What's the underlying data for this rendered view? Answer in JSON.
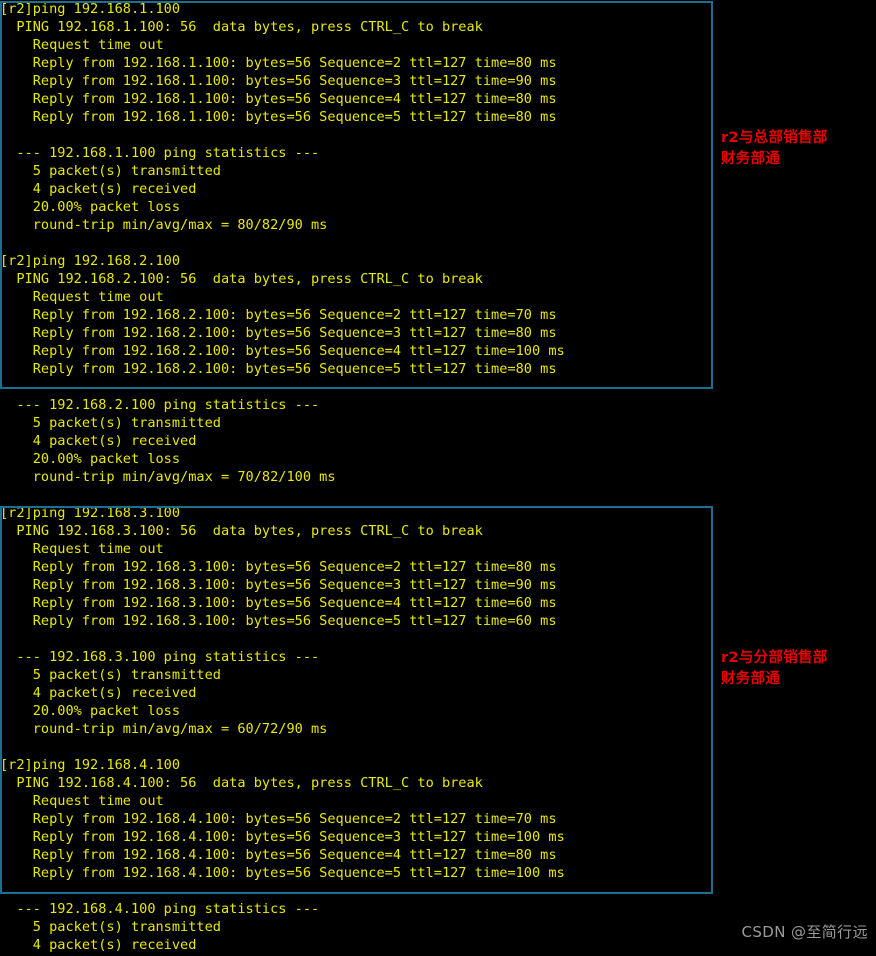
{
  "terminal": {
    "prompt_host": "r2",
    "text_color": "#e8e800",
    "background_color": "#000000",
    "lines": [
      "[r2]ping 192.168.1.100",
      "  PING 192.168.1.100: 56  data bytes, press CTRL_C to break",
      "    Request time out",
      "    Reply from 192.168.1.100: bytes=56 Sequence=2 ttl=127 time=80 ms",
      "    Reply from 192.168.1.100: bytes=56 Sequence=3 ttl=127 time=90 ms",
      "    Reply from 192.168.1.100: bytes=56 Sequence=4 ttl=127 time=80 ms",
      "    Reply from 192.168.1.100: bytes=56 Sequence=5 ttl=127 time=80 ms",
      "",
      "  --- 192.168.1.100 ping statistics ---",
      "    5 packet(s) transmitted",
      "    4 packet(s) received",
      "    20.00% packet loss",
      "    round-trip min/avg/max = 80/82/90 ms",
      "",
      "[r2]ping 192.168.2.100",
      "  PING 192.168.2.100: 56  data bytes, press CTRL_C to break",
      "    Request time out",
      "    Reply from 192.168.2.100: bytes=56 Sequence=2 ttl=127 time=70 ms",
      "    Reply from 192.168.2.100: bytes=56 Sequence=3 ttl=127 time=80 ms",
      "    Reply from 192.168.2.100: bytes=56 Sequence=4 ttl=127 time=100 ms",
      "    Reply from 192.168.2.100: bytes=56 Sequence=5 ttl=127 time=80 ms",
      "",
      "  --- 192.168.2.100 ping statistics ---",
      "    5 packet(s) transmitted",
      "    4 packet(s) received",
      "    20.00% packet loss",
      "    round-trip min/avg/max = 70/82/100 ms",
      "",
      "[r2]ping 192.168.3.100",
      "  PING 192.168.3.100: 56  data bytes, press CTRL_C to break",
      "    Request time out",
      "    Reply from 192.168.3.100: bytes=56 Sequence=2 ttl=127 time=80 ms",
      "    Reply from 192.168.3.100: bytes=56 Sequence=3 ttl=127 time=90 ms",
      "    Reply from 192.168.3.100: bytes=56 Sequence=4 ttl=127 time=60 ms",
      "    Reply from 192.168.3.100: bytes=56 Sequence=5 ttl=127 time=60 ms",
      "",
      "  --- 192.168.3.100 ping statistics ---",
      "    5 packet(s) transmitted",
      "    4 packet(s) received",
      "    20.00% packet loss",
      "    round-trip min/avg/max = 60/72/90 ms",
      "",
      "[r2]ping 192.168.4.100",
      "  PING 192.168.4.100: 56  data bytes, press CTRL_C to break",
      "    Request time out",
      "    Reply from 192.168.4.100: bytes=56 Sequence=2 ttl=127 time=70 ms",
      "    Reply from 192.168.4.100: bytes=56 Sequence=3 ttl=127 time=100 ms",
      "    Reply from 192.168.4.100: bytes=56 Sequence=4 ttl=127 time=80 ms",
      "    Reply from 192.168.4.100: bytes=56 Sequence=5 ttl=127 time=100 ms",
      "",
      "  --- 192.168.4.100 ping statistics ---",
      "    5 packet(s) transmitted",
      "    4 packet(s) received"
    ]
  },
  "highlight_boxes": [
    {
      "id": "hl-box-1",
      "label": "ping-block-1-and-2-highlight",
      "color": "#1b6f91"
    },
    {
      "id": "hl-box-2",
      "label": "ping-block-3-and-4-highlight",
      "color": "#1b6f91"
    }
  ],
  "annotations": [
    {
      "id": "annotation-1",
      "text": "r2与总部销售部\n财务部通",
      "color": "#e60000"
    },
    {
      "id": "annotation-2",
      "text": "r2与分部销售部\n财务部通",
      "color": "#e60000"
    }
  ],
  "watermark": {
    "text": "CSDN @至简行远",
    "color": "#9a9a9a"
  }
}
